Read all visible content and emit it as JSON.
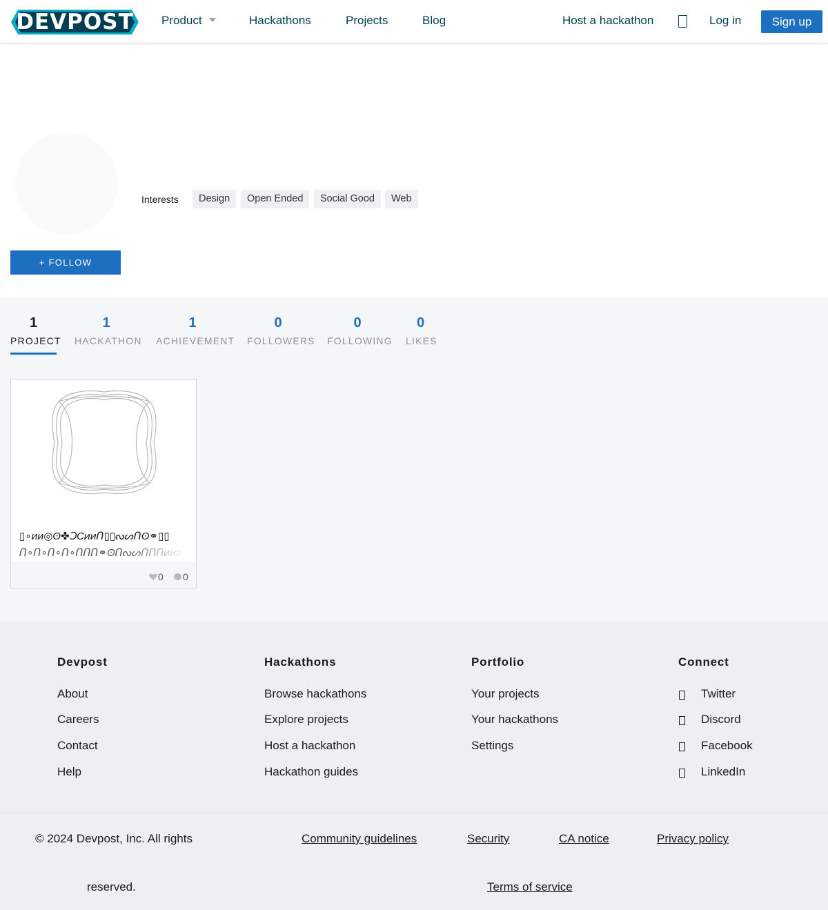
{
  "header": {
    "logo": "DEVPOST",
    "nav": {
      "product": "Product",
      "hackathons": "Hackathons",
      "projects": "Projects",
      "blog": "Blog",
      "host": "Host a hackathon",
      "login": "Log in",
      "signup": "Sign up"
    }
  },
  "profile": {
    "interests_label": "Interests",
    "interests": [
      "Design",
      "Open Ended",
      "Social Good",
      "Web"
    ],
    "follow_label": "+ FOLLOW"
  },
  "stats": [
    {
      "value": "1",
      "label": "PROJECT"
    },
    {
      "value": "1",
      "label": "HACKATHON"
    },
    {
      "value": "1",
      "label": "ACHIEVEMENT"
    },
    {
      "value": "0",
      "label": "FOLLOWERS"
    },
    {
      "value": "0",
      "label": "FOLLOWING"
    },
    {
      "value": "0",
      "label": "LIKES"
    }
  ],
  "project_card": {
    "title_line1": "▯∘ᴎᴎ◎ʘ✤ↃCᴎᴎᑎ▯▯ᔓᔕᑎʘ⚭▯▯",
    "title_line2": "ᑎ∘ᑎ∘ᑎ∘ᑎ∘ᑎᑎᑎ⚭ʘᑎᔓᔕᑎᑎᑎᴎᴎↄ",
    "likes": "0",
    "comments": "0"
  },
  "footer": {
    "columns": [
      {
        "heading": "Devpost",
        "links": [
          "About",
          "Careers",
          "Contact",
          "Help"
        ]
      },
      {
        "heading": "Hackathons",
        "links": [
          "Browse hackathons",
          "Explore projects",
          "Host a hackathon",
          "Hackathon guides"
        ]
      },
      {
        "heading": "Portfolio",
        "links": [
          "Your projects",
          "Your hackathons",
          "Settings"
        ]
      },
      {
        "heading": "Connect",
        "links": [
          "Twitter",
          "Discord",
          "Facebook",
          "LinkedIn"
        ]
      }
    ],
    "connect_icons": [
      "twitter-icon",
      "discord-icon",
      "facebook-icon",
      "linkedin-icon"
    ],
    "copyright_line1": "© 2024 Devpost, Inc. All rights",
    "copyright_line2": "reserved.",
    "legal_links": [
      "Community guidelines",
      "Security",
      "CA notice",
      "Privacy policy",
      "Terms of service"
    ]
  },
  "colors": {
    "brand_dark": "#003e54",
    "brand_teal": "#0ba8c8",
    "primary_blue": "#1d6fc0"
  }
}
